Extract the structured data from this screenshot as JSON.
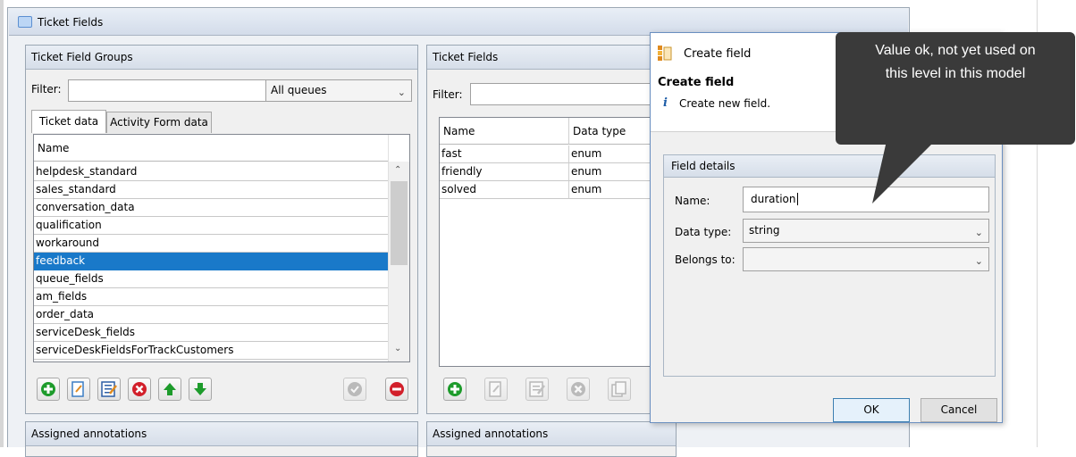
{
  "window": {
    "title": "Ticket Fields"
  },
  "left_panel": {
    "title": "Ticket Field Groups",
    "filter_label": "Filter:",
    "filter_value": "",
    "queue_select": "All queues",
    "tabs": [
      {
        "label": "Ticket data",
        "active": true
      },
      {
        "label": "Activity Form data",
        "active": false
      }
    ],
    "column_header": "Name",
    "rows": [
      {
        "name": "helpdesk_standard",
        "selected": false
      },
      {
        "name": "sales_standard",
        "selected": false
      },
      {
        "name": "conversation_data",
        "selected": false
      },
      {
        "name": "qualification",
        "selected": false
      },
      {
        "name": "workaround",
        "selected": false
      },
      {
        "name": "feedback",
        "selected": true
      },
      {
        "name": "queue_fields",
        "selected": false
      },
      {
        "name": "am_fields",
        "selected": false
      },
      {
        "name": "order_data",
        "selected": false
      },
      {
        "name": "serviceDesk_fields",
        "selected": false
      },
      {
        "name": "serviceDeskFieldsForTrackCustomers",
        "selected": false
      }
    ],
    "toolbar": [
      "add-icon",
      "edit-icon",
      "edit-details-icon",
      "delete-icon",
      "move-up-icon",
      "move-down-icon",
      "check-icon",
      "remove-icon"
    ]
  },
  "middle_panel": {
    "title": "Ticket Fields",
    "filter_label": "Filter:",
    "filter_value": "",
    "columns": [
      "Name",
      "Data type"
    ],
    "rows": [
      {
        "name": "fast",
        "type": "enum"
      },
      {
        "name": "friendly",
        "type": "enum"
      },
      {
        "name": "solved",
        "type": "enum"
      }
    ],
    "toolbar": [
      "add-icon",
      "edit-icon",
      "edit-details-icon",
      "delete-icon",
      "copy-icon"
    ]
  },
  "bottom": {
    "left_title": "Assigned annotations",
    "middle_title": "Assigned annotations"
  },
  "dialog": {
    "title": "Create field",
    "heading": "Create field",
    "info_icon": "i",
    "description": "Create new field.",
    "group_title": "Field details",
    "name_label": "Name:",
    "name_value": "duration",
    "type_label": "Data type:",
    "type_value": "string",
    "belongs_label": "Belongs to:",
    "belongs_value": "",
    "ok_label": "OK",
    "cancel_label": "Cancel"
  },
  "callout": {
    "line1": "Value ok, not yet used on",
    "line2": "this level in this model"
  },
  "colors": {
    "selection": "#1979c9",
    "callout_bg": "#3a3a3a",
    "add_green": "#1d9b2b",
    "delete_red": "#d21f2a"
  }
}
